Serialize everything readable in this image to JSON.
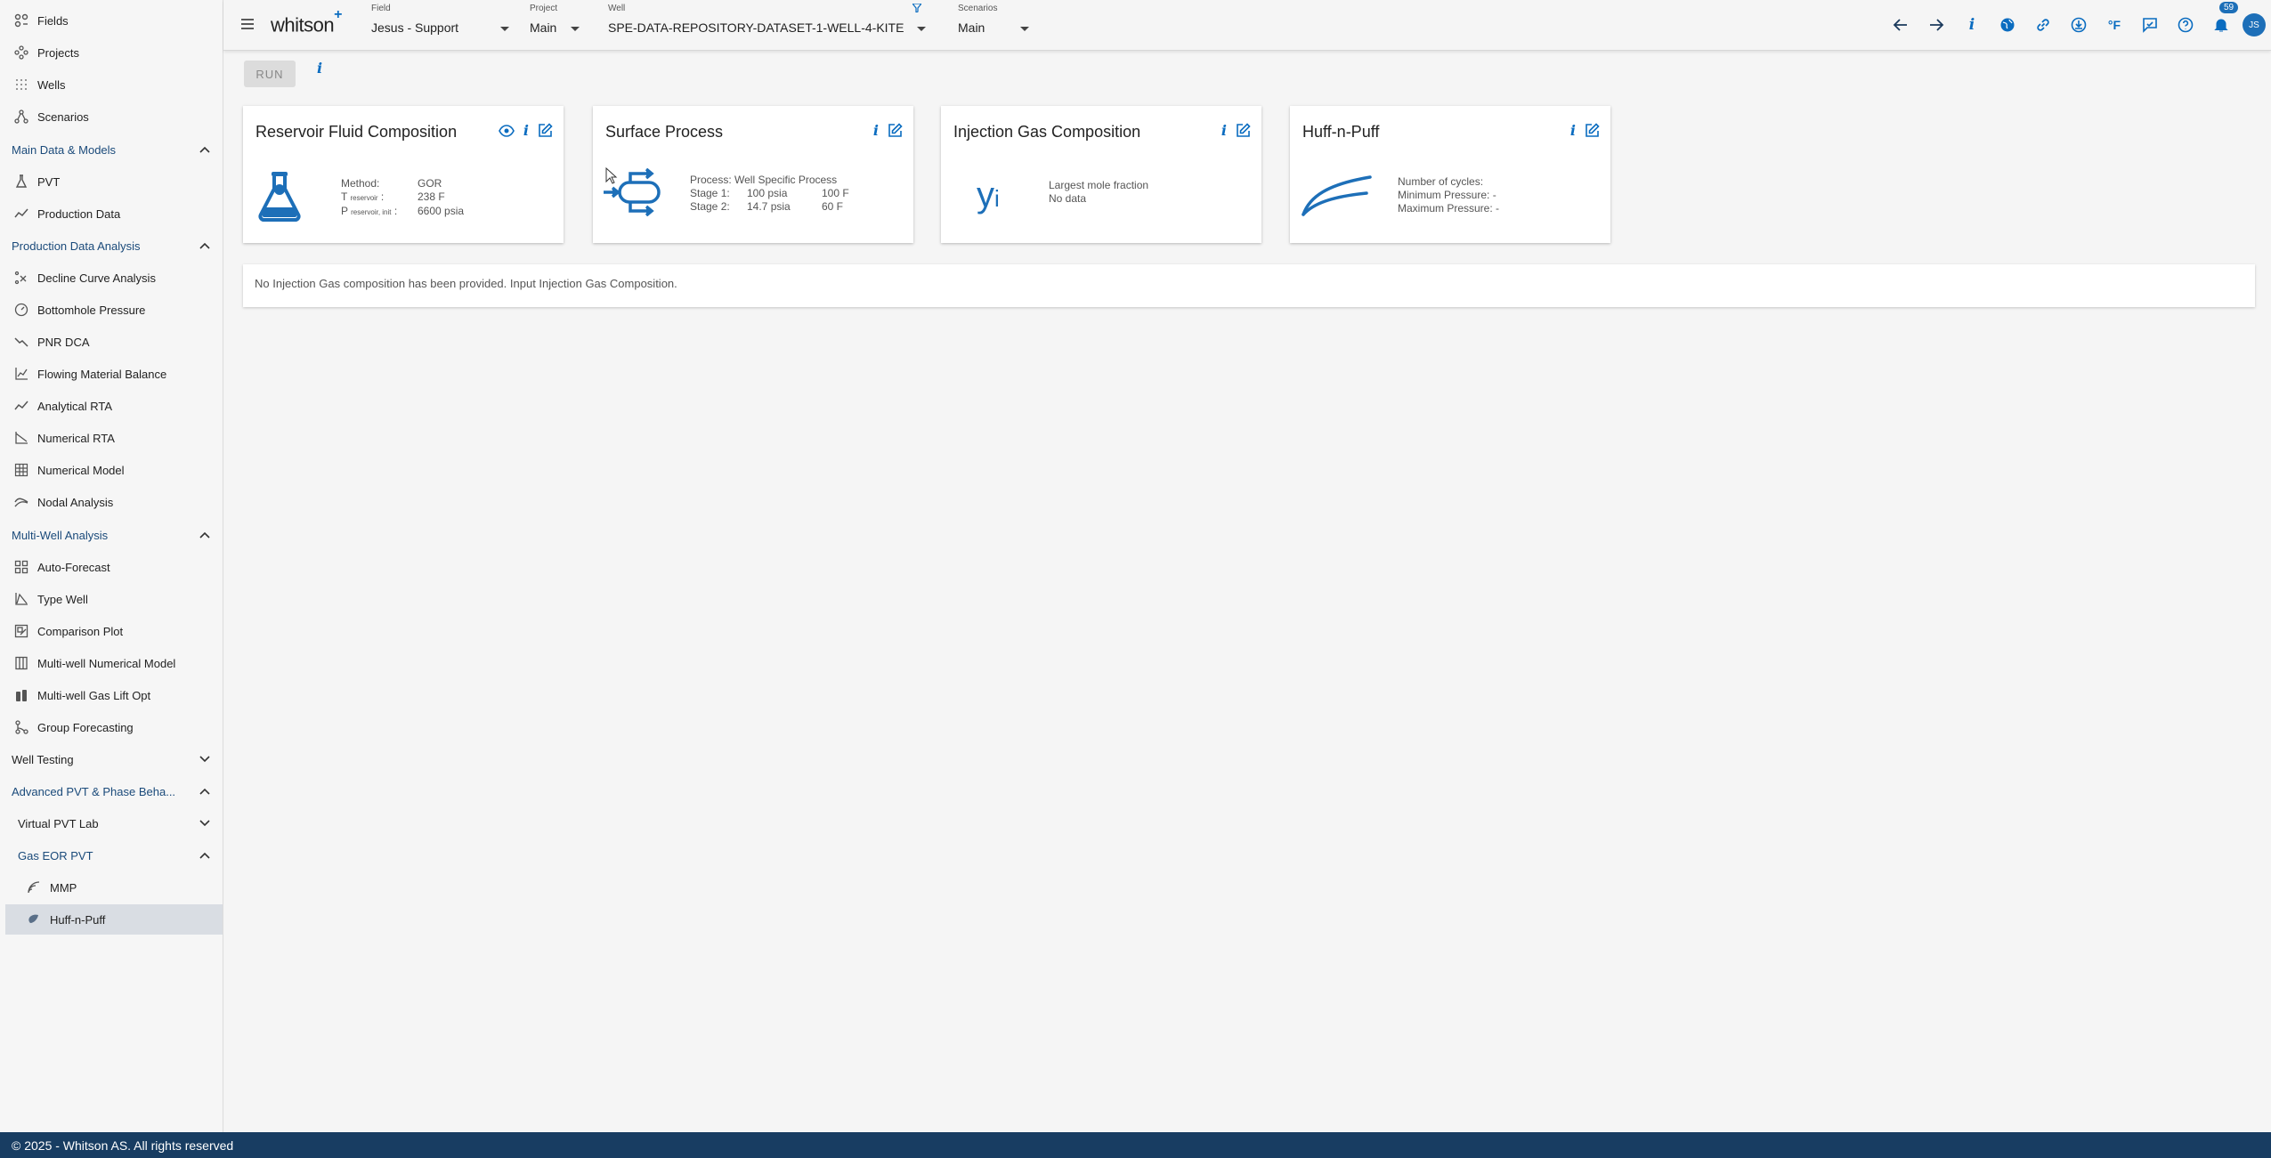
{
  "sidebar": {
    "top_items": [
      {
        "label": "Fields",
        "icon": "fields-icon"
      },
      {
        "label": "Projects",
        "icon": "projects-icon"
      },
      {
        "label": "Wells",
        "icon": "wells-icon"
      },
      {
        "label": "Scenarios",
        "icon": "scenarios-icon"
      }
    ],
    "main_data": {
      "label": "Main Data & Models",
      "items": [
        "PVT",
        "Production Data"
      ]
    },
    "pda": {
      "label": "Production Data Analysis",
      "items": [
        "Decline Curve Analysis",
        "Bottomhole Pressure",
        "PNR DCA",
        "Flowing Material Balance",
        "Analytical RTA",
        "Numerical RTA",
        "Numerical Model",
        "Nodal Analysis"
      ]
    },
    "mwa": {
      "label": "Multi-Well Analysis",
      "items": [
        "Auto-Forecast",
        "Type Well",
        "Comparison Plot",
        "Multi-well Numerical Model",
        "Multi-well Gas Lift Opt",
        "Group Forecasting"
      ]
    },
    "well_testing": {
      "label": "Well Testing"
    },
    "adv_pvt": {
      "label": "Advanced PVT & Phase Beha..."
    },
    "virtual_lab": {
      "label": "Virtual PVT Lab"
    },
    "gas_eor": {
      "label": "Gas EOR PVT",
      "items": [
        "MMP",
        "Huff-n-Puff"
      ]
    }
  },
  "header": {
    "logo": "whitson",
    "logo_plus": "+",
    "field": {
      "caption": "Field",
      "value": "Jesus - Support"
    },
    "project": {
      "caption": "Project",
      "value": "Main"
    },
    "well": {
      "caption": "Well",
      "value": "SPE-DATA-REPOSITORY-DATASET-1-WELL-4-KITE"
    },
    "scenarios": {
      "caption": "Scenarios",
      "value": "Main"
    },
    "notification_count": "59",
    "unit_label": "°F",
    "avatar_initials": "JS"
  },
  "toolbar": {
    "run_label": "RUN",
    "info_label": "i"
  },
  "cards": {
    "reservoir": {
      "title": "Reservoir Fluid Composition",
      "method_label": "Method:",
      "method_value": "GOR",
      "t_label": "T",
      "t_sub": "reservoir",
      "t_value": "238 F",
      "p_label": "P",
      "p_sub": "reservoir, init",
      "p_value": "6600 psia"
    },
    "surface": {
      "title": "Surface Process",
      "process": "Process: Well Specific Process",
      "stage1_label": "Stage 1:",
      "stage1_p": "100 psia",
      "stage1_t": "100 F",
      "stage2_label": "Stage 2:",
      "stage2_p": "14.7 psia",
      "stage2_t": "60 F"
    },
    "injection": {
      "title": "Injection Gas Composition",
      "symbol": "y",
      "symbol_sub": "i",
      "line1": "Largest mole fraction",
      "line2": "No data"
    },
    "huff": {
      "title": "Huff-n-Puff",
      "cycles": "Number of cycles:",
      "min_p": "Minimum Pressure:",
      "min_p_val": "-",
      "max_p": "Maximum Pressure:",
      "max_p_val": "-"
    }
  },
  "notice": "No Injection Gas composition has been provided. Input Injection Gas Composition.",
  "footer": "© 2025 - Whitson AS. All rights reserved",
  "colors": {
    "accent": "#0a6cc0",
    "footer_bg": "#183d62",
    "active_bg": "#d9dde3"
  }
}
